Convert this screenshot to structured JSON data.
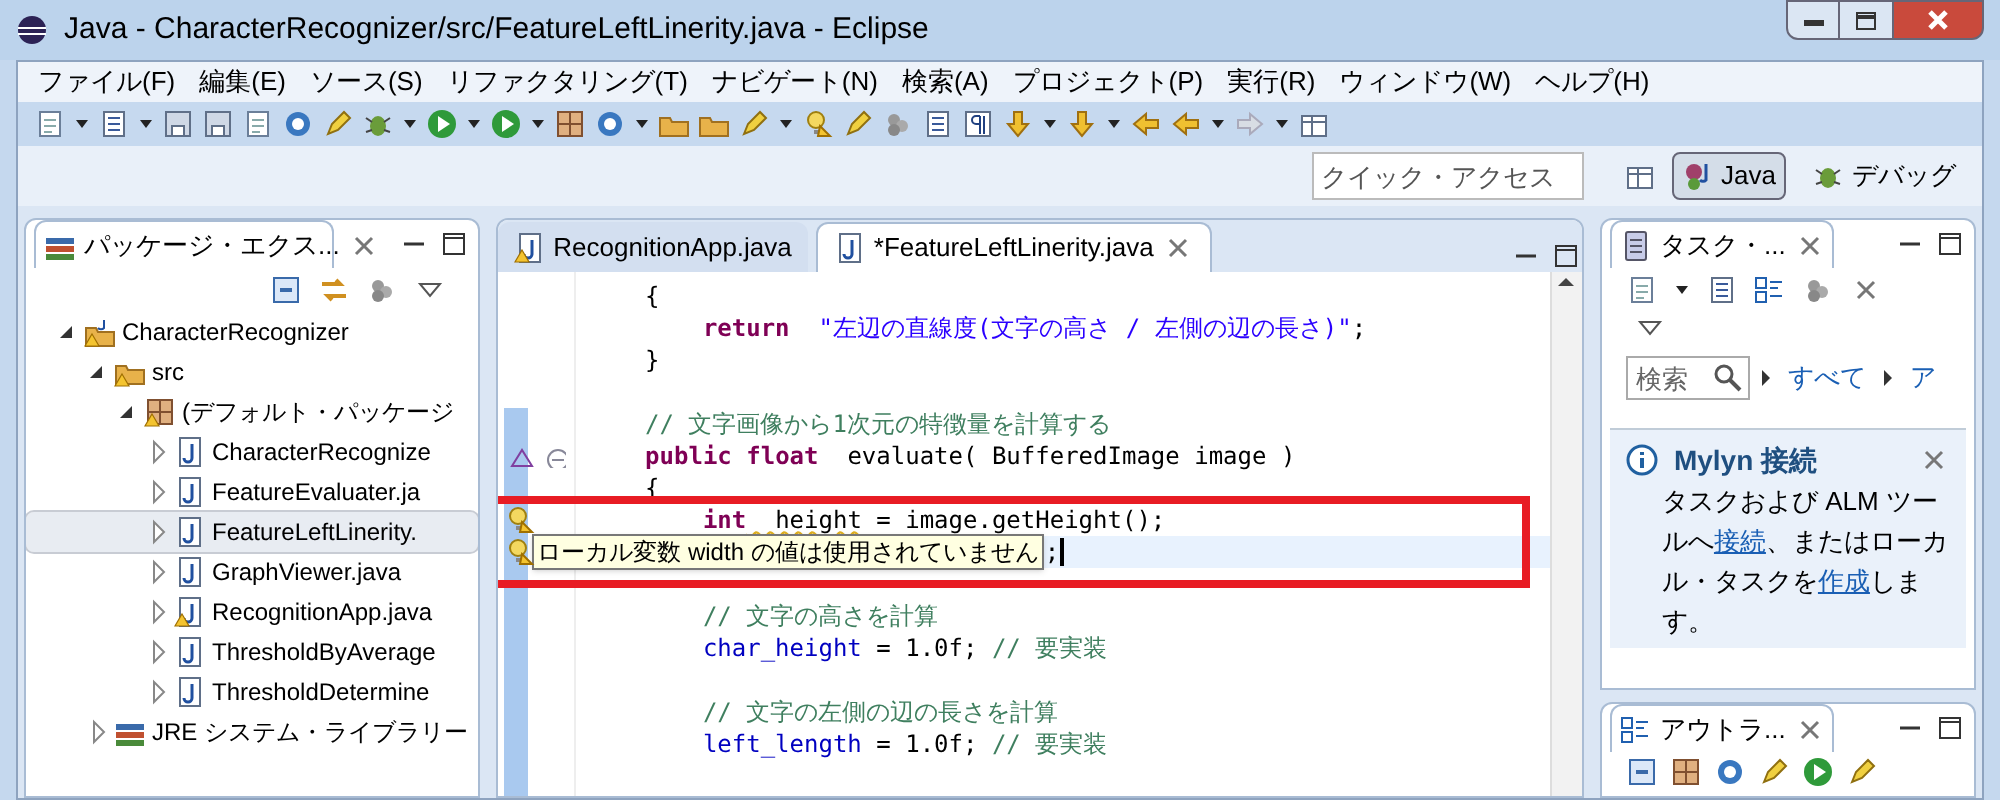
{
  "window": {
    "title": "Java - CharacterRecognizer/src/FeatureLeftLinerity.java - Eclipse"
  },
  "menu": [
    "ファイル(F)",
    "編集(E)",
    "ソース(S)",
    "リファクタリング(T)",
    "ナビゲート(N)",
    "検索(A)",
    "プロジェクト(P)",
    "実行(R)",
    "ウィンドウ(W)",
    "ヘルプ(H)"
  ],
  "quick_access": {
    "placeholder": "クイック・アクセス"
  },
  "perspectives": [
    {
      "label": "Java",
      "selected": true
    },
    {
      "label": "デバッグ",
      "selected": false
    }
  ],
  "package_explorer": {
    "title": "パッケージ・エクス...",
    "tree": [
      {
        "label": "CharacterRecognizer",
        "kind": "project",
        "expanded": true,
        "warning": true,
        "selected": false,
        "children": [
          {
            "label": "src",
            "kind": "folder",
            "expanded": true,
            "warning": true,
            "selected": false,
            "children": [
              {
                "label": "(デフォルト・パッケージ",
                "kind": "package",
                "expanded": true,
                "warning": true,
                "selected": false,
                "children": [
                  {
                    "label": "CharacterRecognize",
                    "kind": "file",
                    "expanded": false,
                    "warning": false,
                    "selected": false
                  },
                  {
                    "label": "FeatureEvaluater.ja",
                    "kind": "file",
                    "expanded": false,
                    "warning": false,
                    "selected": false
                  },
                  {
                    "label": "FeatureLeftLinerity.",
                    "kind": "file",
                    "expanded": false,
                    "warning": false,
                    "selected": true
                  },
                  {
                    "label": "GraphViewer.java",
                    "kind": "file",
                    "expanded": false,
                    "warning": false,
                    "selected": false
                  },
                  {
                    "label": "RecognitionApp.java",
                    "kind": "file",
                    "expanded": false,
                    "warning": true,
                    "selected": false
                  },
                  {
                    "label": "ThresholdByAverage",
                    "kind": "file",
                    "expanded": false,
                    "warning": false,
                    "selected": false
                  },
                  {
                    "label": "ThresholdDetermine",
                    "kind": "file",
                    "expanded": false,
                    "warning": false,
                    "selected": false
                  }
                ]
              }
            ]
          },
          {
            "label": "JRE システム・ライブラリー",
            "kind": "library",
            "expanded": false,
            "warning": false,
            "selected": false
          }
        ]
      }
    ]
  },
  "editor": {
    "tabs": [
      {
        "label": "RecognitionApp.java",
        "selected": false,
        "warning": true
      },
      {
        "label": "*FeatureLeftLinerity.java",
        "selected": true,
        "warning": false
      }
    ],
    "lines": [
      {
        "kind": "plain",
        "current": false,
        "tokens": [
          {
            "kind": "plain",
            "text": "    {"
          }
        ]
      },
      {
        "kind": "plain",
        "current": false,
        "tokens": [
          {
            "kind": "keyword",
            "text": "        return"
          },
          {
            "kind": "string",
            "text": "  \"左辺の直線度(文字の高さ / 左側の辺の長さ)\""
          },
          {
            "kind": "plain",
            "text": ";"
          }
        ]
      },
      {
        "kind": "plain",
        "current": false,
        "tokens": [
          {
            "kind": "plain",
            "text": "    }"
          }
        ]
      },
      {
        "kind": "blank",
        "current": false
      },
      {
        "kind": "plain",
        "current": false,
        "tokens": [
          {
            "kind": "comment",
            "text": "    // 文字画像から1次元の特徴量を計算する"
          }
        ]
      },
      {
        "kind": "override",
        "current": false,
        "tokens": [
          {
            "kind": "keyword",
            "text": "    public"
          },
          {
            "kind": "keyword",
            "text": " float"
          },
          {
            "kind": "plain",
            "text": "  evaluate( BufferedImage image )"
          }
        ]
      },
      {
        "kind": "plain",
        "current": false,
        "tokens": [
          {
            "kind": "plain",
            "text": "    {"
          }
        ]
      },
      {
        "kind": "warning",
        "current": false,
        "tokens": [
          {
            "kind": "keyword",
            "text": "        int"
          },
          {
            "kind": "warned",
            "text": "  height"
          },
          {
            "kind": "plain",
            "text": " = image.getHeight();"
          }
        ]
      },
      {
        "kind": "warning",
        "current": true,
        "tooltip": "ローカル変数 width の値は使用されていません",
        "tokens": [
          {
            "kind": "plain",
            "text": ";"
          }
        ]
      },
      {
        "kind": "blank",
        "current": false
      },
      {
        "kind": "plain",
        "current": false,
        "tokens": [
          {
            "kind": "comment",
            "text": "        // 文字の高さを計算"
          }
        ]
      },
      {
        "kind": "plain",
        "current": false,
        "tokens": [
          {
            "kind": "field",
            "text": "        char_height"
          },
          {
            "kind": "plain",
            "text": " = 1.0f; "
          },
          {
            "kind": "comment",
            "text": "// 要実装"
          }
        ]
      },
      {
        "kind": "blank",
        "current": false
      },
      {
        "kind": "plain",
        "current": false,
        "tokens": [
          {
            "kind": "comment",
            "text": "        // 文字の左側の辺の長さを計算"
          }
        ]
      },
      {
        "kind": "plain",
        "current": false,
        "tokens": [
          {
            "kind": "field",
            "text": "        left_length"
          },
          {
            "kind": "plain",
            "text": " = 1.0f; "
          },
          {
            "kind": "comment",
            "text": "// 要実装"
          }
        ]
      }
    ]
  },
  "task_list": {
    "title": "タスク・...",
    "search": {
      "placeholder": "検索"
    },
    "filters": [
      "すべて",
      "ア"
    ]
  },
  "mylyn": {
    "title": "Mylyn 接続",
    "text": [
      {
        "kind": "text",
        "text": "タスクおよび ALM ツールへ"
      },
      {
        "kind": "link",
        "text": "接続"
      },
      {
        "kind": "text",
        "text": "、またはローカル・タスクを"
      },
      {
        "kind": "link",
        "text": "作成"
      },
      {
        "kind": "text",
        "text": "します。"
      }
    ]
  },
  "outline": {
    "title": "アウトラ..."
  }
}
